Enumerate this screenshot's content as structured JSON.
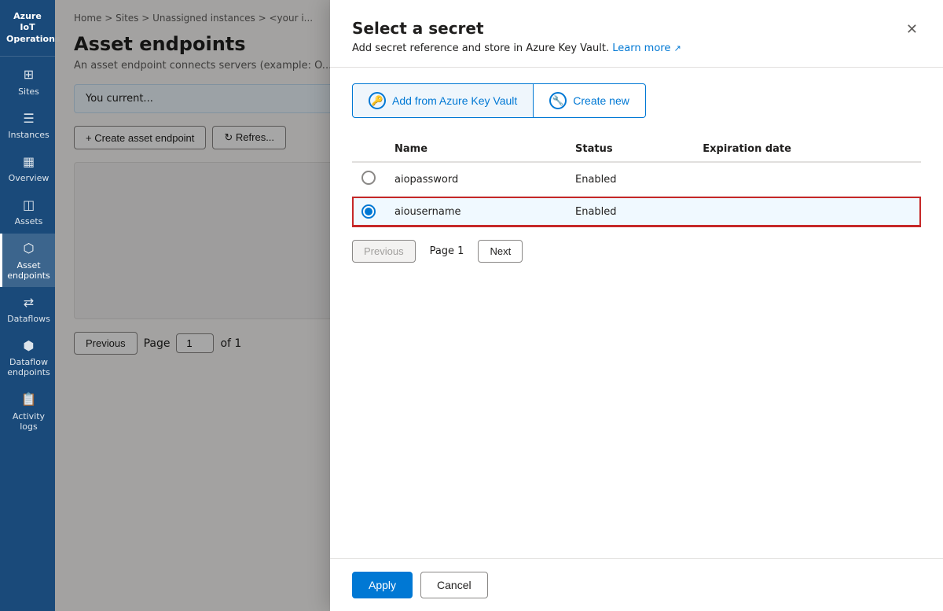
{
  "app": {
    "title": "Azure IoT Operations"
  },
  "sidebar": {
    "items": [
      {
        "id": "sites",
        "label": "Sites",
        "icon": "⊞"
      },
      {
        "id": "instances",
        "label": "Instances",
        "icon": "≡"
      },
      {
        "id": "overview",
        "label": "Overview",
        "icon": "⬚"
      },
      {
        "id": "assets",
        "label": "Assets",
        "icon": "◫"
      },
      {
        "id": "asset-endpoints",
        "label": "Asset endpoints",
        "icon": "⬡",
        "active": true
      },
      {
        "id": "dataflows",
        "label": "Dataflows",
        "icon": "⇄"
      },
      {
        "id": "dataflow-endpoints",
        "label": "Dataflow endpoints",
        "icon": "⬢"
      },
      {
        "id": "activity-logs",
        "label": "Activity logs",
        "icon": "☰"
      }
    ]
  },
  "breadcrumb": {
    "text": "Home > Sites > Unassigned instances > <your i..."
  },
  "page": {
    "title": "Asset endpoints",
    "description": "An asset endpoint connects servers (example: O...",
    "info_banner": "You current..."
  },
  "toolbar": {
    "create_label": "+ Create asset endpoint",
    "refresh_label": "↻ Refres..."
  },
  "pagination": {
    "previous_label": "Previous",
    "page_label": "Page",
    "page_value": "1",
    "of_label": "of 1"
  },
  "modal": {
    "title": "Select a secret",
    "subtitle": "Add secret reference and store in Azure Key Vault.",
    "learn_more_label": "Learn more",
    "close_icon": "✕",
    "add_from_vault_label": "Add from Azure Key Vault",
    "create_new_label": "Create new",
    "table": {
      "col_name": "Name",
      "col_status": "Status",
      "col_expiration": "Expiration date",
      "rows": [
        {
          "id": "row1",
          "name": "aiopassword",
          "status": "Enabled",
          "expiration": "",
          "selected": false
        },
        {
          "id": "row2",
          "name": "aiousername",
          "status": "Enabled",
          "expiration": "",
          "selected": true
        }
      ]
    },
    "pagination": {
      "previous_label": "Previous",
      "page_label": "Page 1",
      "next_label": "Next"
    },
    "footer": {
      "apply_label": "Apply",
      "cancel_label": "Cancel"
    }
  }
}
